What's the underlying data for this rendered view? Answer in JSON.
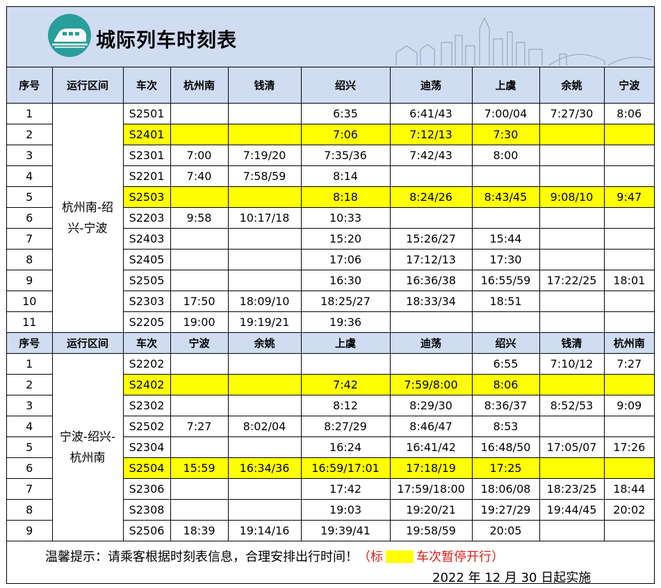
{
  "title": "城际列车时刻表",
  "colors": {
    "header_bg": "#cfdcf2",
    "highlight": "#ffff00",
    "note_red": "#e0201b",
    "logo": "#2a9e9a"
  },
  "logo_icon": "train-icon",
  "table1": {
    "headers": [
      "序号",
      "运行区间",
      "车次",
      "杭州南",
      "钱清",
      "绍兴",
      "迪荡",
      "上虞",
      "余姚",
      "宁波"
    ],
    "route": "杭州南-绍兴-宁波",
    "highlighted_rows": [
      1,
      4
    ],
    "rows": [
      [
        "1",
        "S2501",
        "",
        "",
        "6:35",
        "6:41/43",
        "7:00/04",
        "7:27/30",
        "8:06"
      ],
      [
        "2",
        "S2401",
        "",
        "",
        "7:06",
        "7:12/13",
        "7:30",
        "",
        ""
      ],
      [
        "3",
        "S2301",
        "7:00",
        "7:19/20",
        "7:35/36",
        "7:42/43",
        "8:00",
        "",
        ""
      ],
      [
        "4",
        "S2201",
        "7:40",
        "7:58/59",
        "8:14",
        "",
        "",
        "",
        ""
      ],
      [
        "5",
        "S2503",
        "",
        "",
        "8:18",
        "8:24/26",
        "8:43/45",
        "9:08/10",
        "9:47"
      ],
      [
        "6",
        "S2203",
        "9:58",
        "10:17/18",
        "10:33",
        "",
        "",
        "",
        ""
      ],
      [
        "7",
        "S2403",
        "",
        "",
        "15:20",
        "15:26/27",
        "15:44",
        "",
        ""
      ],
      [
        "8",
        "S2405",
        "",
        "",
        "17:06",
        "17:12/13",
        "17:30",
        "",
        ""
      ],
      [
        "9",
        "S2505",
        "",
        "",
        "16:30",
        "16:36/38",
        "16:55/59",
        "17:22/25",
        "18:01"
      ],
      [
        "10",
        "S2303",
        "17:50",
        "18:09/10",
        "18:25/27",
        "18:33/34",
        "18:51",
        "",
        ""
      ],
      [
        "11",
        "S2205",
        "19:00",
        "19:19/21",
        "19:36",
        "",
        "",
        "",
        ""
      ]
    ]
  },
  "table2": {
    "headers": [
      "序号",
      "运行区间",
      "车次",
      "宁波",
      "余姚",
      "上虞",
      "迪荡",
      "绍兴",
      "钱清",
      "杭州南"
    ],
    "route": "宁波-绍兴-杭州南",
    "highlighted_rows": [
      1,
      5
    ],
    "rows": [
      [
        "1",
        "S2202",
        "",
        "",
        "",
        "",
        "6:55",
        "7:10/12",
        "7:27"
      ],
      [
        "2",
        "S2402",
        "",
        "",
        "7:42",
        "7:59/8:00",
        "8:06",
        "",
        ""
      ],
      [
        "3",
        "S2302",
        "",
        "",
        "8:12",
        "8:29/30",
        "8:36/37",
        "8:52/53",
        "9:09"
      ],
      [
        "4",
        "S2502",
        "7:27",
        "8:02/04",
        "8:27/29",
        "8:46/47",
        "8:53",
        "",
        ""
      ],
      [
        "5",
        "S2304",
        "",
        "",
        "16:24",
        "16:41/42",
        "16:48/50",
        "17:05/07",
        "17:26"
      ],
      [
        "6",
        "S2504",
        "15:59",
        "16:34/36",
        "16:59/17:01",
        "17:18/19",
        "17:25",
        "",
        ""
      ],
      [
        "7",
        "S2306",
        "",
        "",
        "17:42",
        "17:59/18:00",
        "18:06/08",
        "18:23/25",
        "18:44"
      ],
      [
        "8",
        "S2308",
        "",
        "",
        "19:03",
        "19:20/21",
        "19:27/29",
        "19:44/45",
        "20:02"
      ],
      [
        "9",
        "S2506",
        "18:39",
        "19:14/16",
        "19:39/41",
        "19:58/59",
        "20:05",
        "",
        ""
      ]
    ]
  },
  "footer": {
    "tip": "温馨提示：请乘客根据时刻表信息，合理安排出行时间！",
    "note_open": "（标",
    "note_close": "车次暂停开行）",
    "date": "2022 年 12 月 30 日起实施"
  }
}
